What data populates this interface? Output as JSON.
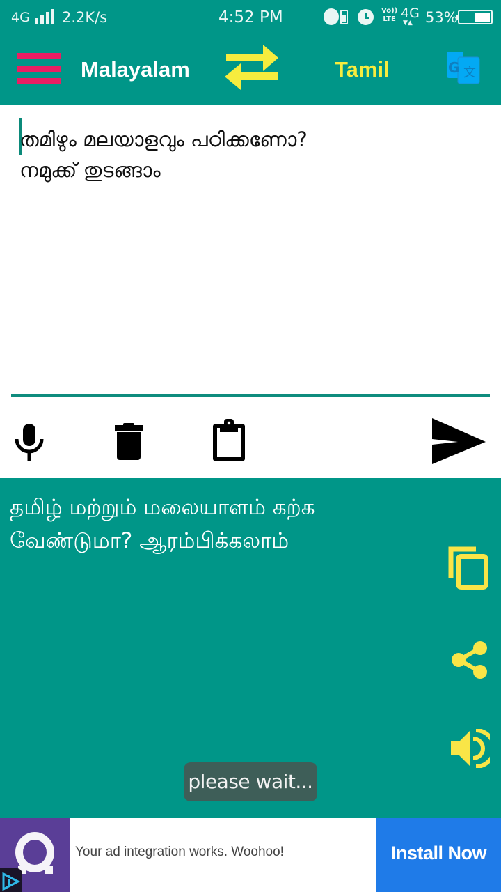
{
  "status_bar": {
    "network_type": "4G",
    "data_speed": "2.2K/s",
    "time": "4:52 PM",
    "volte_top": "Vo))",
    "volte_bottom": "LTE",
    "network_4g": "4G",
    "network_arrows": "▼▲",
    "battery_percent": "53%",
    "battery_level": 0.53,
    "bluetooth_glyph": "ʙ"
  },
  "app_bar": {
    "source_language": "Malayalam",
    "target_language": "Tamil",
    "colors": {
      "background": "#009688",
      "menu": "#e91e63",
      "swap": "#f6ec3e",
      "target_language": "#f6ec3e",
      "translate_icon": "#03a9f4"
    },
    "translate_icon_letters": "G文"
  },
  "input": {
    "text": "തമിഴും മലയാളവും പഠിക്കണോ?\nനമുക്ക് തുടങ്ങാം"
  },
  "output": {
    "text": "தமிழ் மற்றும் மலையாளம் கற்க வேண்டுமா? ஆரம்பிக்கலாம்",
    "icon_color": "#f9e547"
  },
  "toast": {
    "message": "please wait..."
  },
  "ad": {
    "text": "Your ad integration works. Woohoo!",
    "cta": "Install Now"
  }
}
